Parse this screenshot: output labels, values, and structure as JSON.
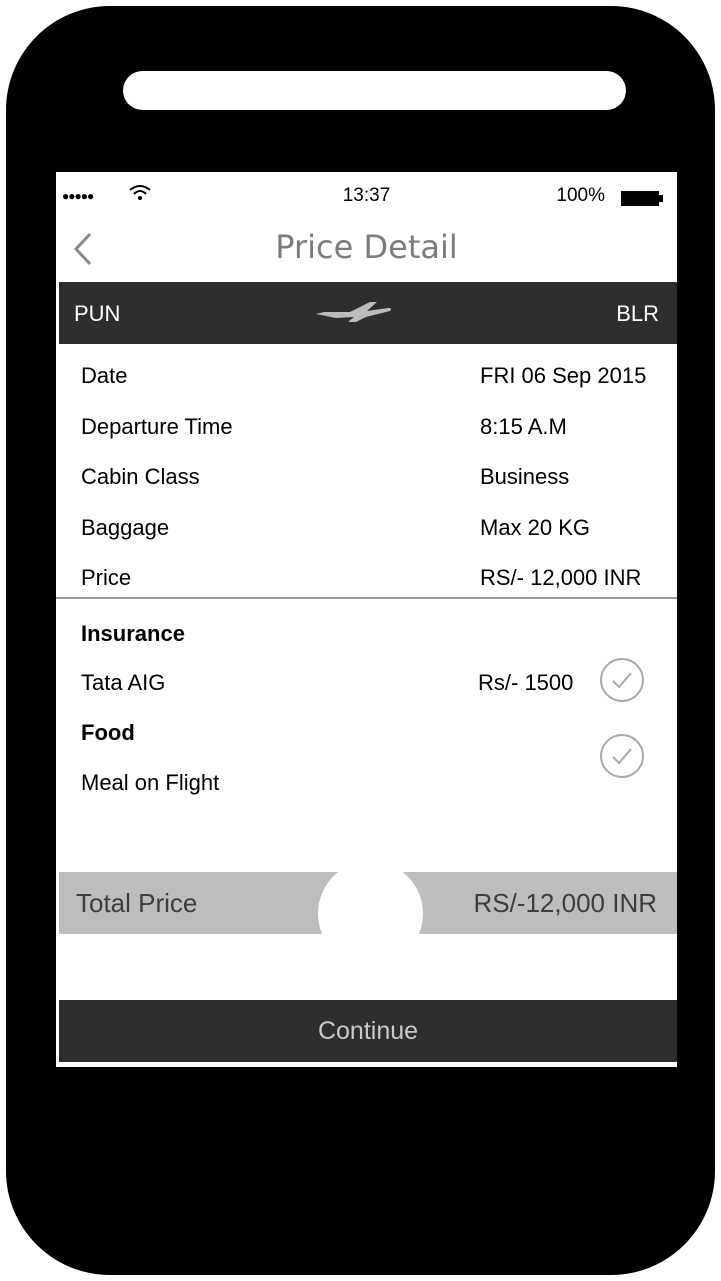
{
  "status_bar": {
    "signal": "●●●●●",
    "time": "13:37",
    "battery": "100%"
  },
  "nav": {
    "title": "Price Detail"
  },
  "route": {
    "from": "PUN",
    "to": "BLR"
  },
  "details": [
    {
      "label": "Date",
      "value": "FRI 06 Sep 2015"
    },
    {
      "label": "Departure Time",
      "value": "8:15 A.M"
    },
    {
      "label": "Cabin Class",
      "value": "Business"
    },
    {
      "label": "Baggage",
      "value": "Max 20 KG"
    },
    {
      "label": "Price",
      "value": "RS/- 12,000 INR"
    }
  ],
  "insurance": {
    "title": "Insurance",
    "item_label": "Tata AIG",
    "item_price": "Rs/- 1500"
  },
  "food": {
    "title": "Food",
    "item_label": "Meal on Flight"
  },
  "total": {
    "label": "Total Price",
    "value": "RS/-12,000 INR"
  },
  "continue_label": "Continue",
  "icons": {
    "back": "chevron-left-icon",
    "plane": "airplane-icon",
    "check": "check-circle-icon",
    "wifi": "wifi-icon",
    "battery": "battery-icon"
  },
  "colors": {
    "dark_bar": "#2e2e2e",
    "total_bar": "#bdbdbd",
    "title_gray": "#7c7c7c"
  }
}
